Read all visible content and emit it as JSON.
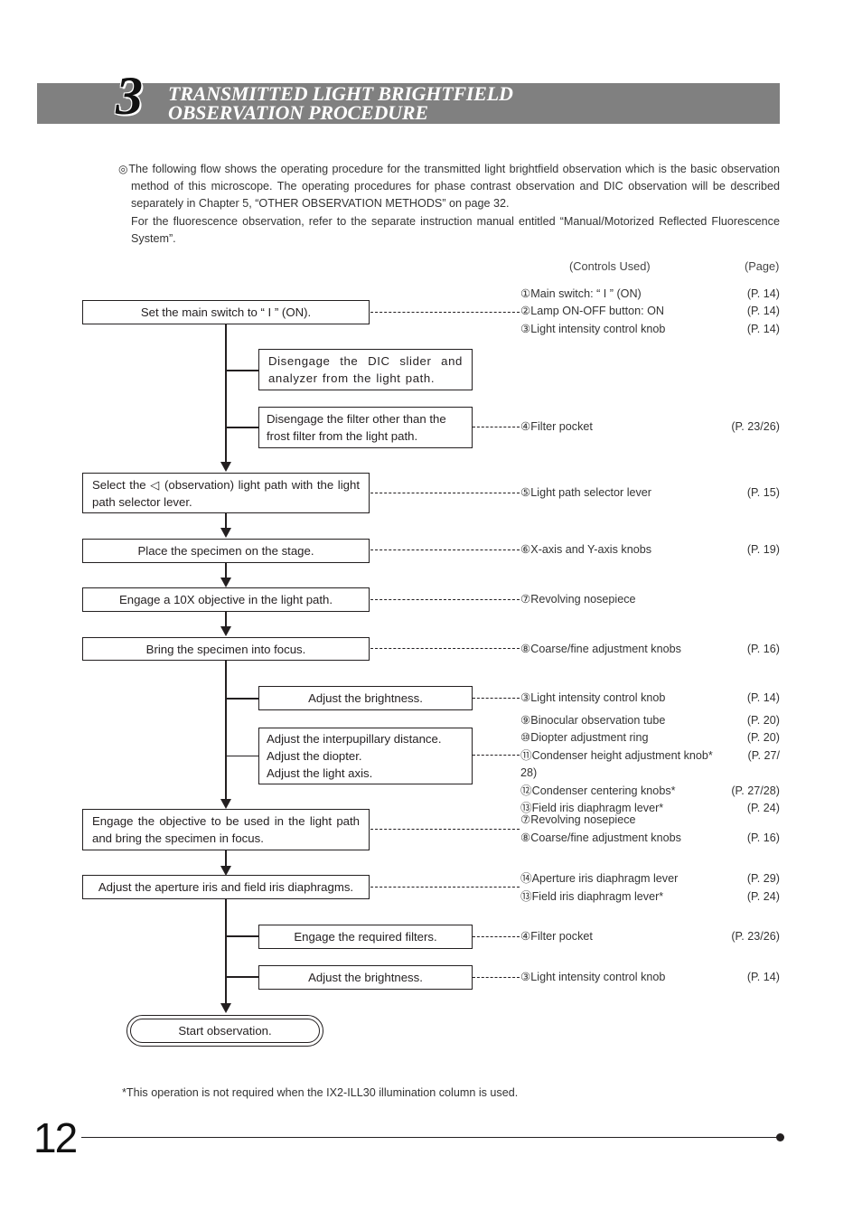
{
  "chapter": {
    "number": "3",
    "title_line1": "TRANSMITTED LIGHT BRIGHTFIELD",
    "title_line2": "OBSERVATION PROCEDURE"
  },
  "intro": {
    "bullet_icon": "◎",
    "paragraph1": "The following flow shows the operating procedure for the transmitted light brightfield observation which is the basic observation method of this microscope. The operating procedures for phase contrast observation and DIC observation will be described separately in Chapter 5, “OTHER OBSERVATION METHODS” on page 32.",
    "paragraph2": "For the fluorescence observation, refer to the separate instruction manual entitled “Manual/Motorized Reflected Fluorescence System”."
  },
  "columns": {
    "controls_used": "(Controls Used)",
    "page": "(Page)"
  },
  "flow": {
    "step1": "Set the main switch to “ I ” (ON).",
    "sub1a": "Disengage the DIC slider and analyzer from the light path.",
    "sub1b": "Disengage the filter other than the frost filter from the light path.",
    "step2": "Select the ◁ (observation) light path with the light path selector lever.",
    "step3": "Place the specimen on the stage.",
    "step4": "Engage a 10X objective in the light path.",
    "step5": "Bring the specimen into focus.",
    "sub5a": "Adjust the brightness.",
    "sub5b_line1": "Adjust the interpupillary distance.",
    "sub5b_line2": "Adjust the diopter.",
    "sub5b_line3": "Adjust the light axis.",
    "step6": "Engage the objective to be used in the light path and bring the specimen in focus.",
    "step7": "Adjust the aperture iris and field iris diaphragms.",
    "sub7a": "Engage the required filters.",
    "sub7b": "Adjust the brightness.",
    "end": "Start observation."
  },
  "controls": {
    "g1": [
      {
        "label": "①Main switch: “ I ” (ON)",
        "page": "(P. 14)"
      },
      {
        "label": "②Lamp ON-OFF button: ON",
        "page": "(P. 14)"
      },
      {
        "label": "③Light intensity control knob",
        "page": "(P. 14)"
      }
    ],
    "g2": [
      {
        "label": "④Filter pocket",
        "page": "(P. 23/26)"
      }
    ],
    "g3": [
      {
        "label": "⑤Light path selector lever",
        "page": "(P. 15)"
      }
    ],
    "g4": [
      {
        "label": "⑥X-axis and Y-axis knobs",
        "page": "(P. 19)"
      }
    ],
    "g5": [
      {
        "label": "⑦Revolving nosepiece",
        "page": ""
      }
    ],
    "g6": [
      {
        "label": "⑧Coarse/fine adjustment knobs",
        "page": "(P. 16)"
      }
    ],
    "g7": [
      {
        "label": "③Light intensity control knob",
        "page": "(P. 14)"
      }
    ],
    "g8": [
      {
        "label": "⑨Binocular observation tube",
        "page": "(P. 20)"
      },
      {
        "label": "⑩Diopter adjustment ring",
        "page": "(P. 20)"
      },
      {
        "label": "⑪Condenser height adjustment knob*",
        "page": "(P. 27/"
      },
      {
        "label": "28)",
        "page": ""
      },
      {
        "label": "⑫Condenser centering knobs*",
        "page": "(P. 27/28)"
      },
      {
        "label": "⑬Field iris diaphragm lever*",
        "page": "(P. 24)"
      }
    ],
    "g9": [
      {
        "label": "⑦Revolving nosepiece",
        "page": ""
      },
      {
        "label": "⑧Coarse/fine adjustment knobs",
        "page": "(P. 16)"
      }
    ],
    "g10": [
      {
        "label": "⑭Aperture iris diaphragm lever",
        "page": "(P. 29)"
      },
      {
        "label": "⑬Field iris diaphragm lever*",
        "page": "(P. 24)"
      }
    ],
    "g11": [
      {
        "label": "④Filter pocket",
        "page": "(P. 23/26)"
      }
    ],
    "g12": [
      {
        "label": "③Light intensity control knob",
        "page": "(P. 14)"
      }
    ]
  },
  "footnote": "*This operation is not required when the IX2-ILL30 illumination column is used.",
  "page_number": "12"
}
